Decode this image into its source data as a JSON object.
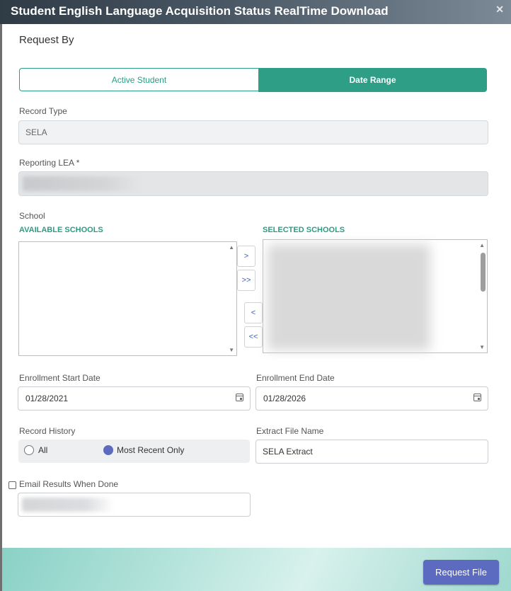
{
  "dialog": {
    "title": "Student English Language Acquisition Status RealTime Download",
    "close_glyph": "✕"
  },
  "request_by": {
    "heading": "Request By",
    "options": [
      "Active Student",
      "Date Range"
    ],
    "selected": "Date Range"
  },
  "record_type": {
    "label": "Record Type",
    "value": "SELA"
  },
  "reporting_lea": {
    "label": "Reporting LEA *",
    "value": ""
  },
  "school": {
    "label": "School",
    "available_label": "AVAILABLE SCHOOLS",
    "selected_label": "SELECTED SCHOOLS",
    "move_buttons": [
      ">",
      ">>",
      "<",
      "<<"
    ]
  },
  "enrollment": {
    "start_label": "Enrollment Start Date",
    "start_value": "01/28/2021",
    "end_label": "Enrollment End Date",
    "end_value": "01/28/2026"
  },
  "record_history": {
    "label": "Record History",
    "options": [
      "All",
      "Most Recent Only"
    ],
    "selected": "Most Recent Only"
  },
  "extract_file": {
    "label": "Extract File Name",
    "value": "SELA Extract"
  },
  "email": {
    "label": "Email Results When Done",
    "checked": false,
    "value": ""
  },
  "footer": {
    "request_button": "Request File"
  },
  "colors": {
    "accent_green": "#2f9e86",
    "primary_button": "#5c6bc0"
  }
}
